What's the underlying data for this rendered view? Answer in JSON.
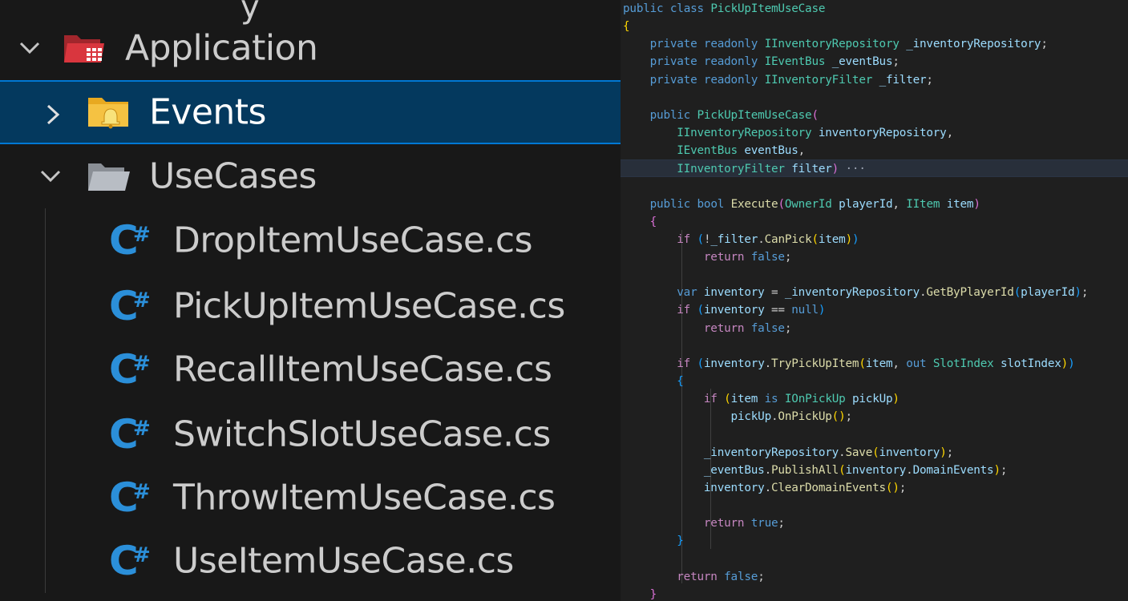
{
  "explorer": {
    "top_fragment": "y",
    "application": {
      "label": "Application",
      "expanded": true
    },
    "events": {
      "label": "Events",
      "expanded": false,
      "selected": true
    },
    "usecases": {
      "label": "UseCases",
      "expanded": true
    },
    "files": [
      {
        "label": "DropItemUseCase.cs"
      },
      {
        "label": "PickUpItemUseCase.cs"
      },
      {
        "label": "RecallItemUseCase.cs"
      },
      {
        "label": "SwitchSlotUseCase.cs"
      },
      {
        "label": "ThrowItemUseCase.cs"
      },
      {
        "label": "UseItemUseCase.cs"
      }
    ],
    "file_icon_text": {
      "c": "C",
      "hash": "#"
    }
  },
  "editor": {
    "colors": {
      "keyword": "#569cd6",
      "type": "#4ec9b0",
      "function": "#dcdcaa",
      "identifier": "#9cdcfe",
      "bracket_level_1": "#ffd700",
      "bracket_level_2": "#da70d6",
      "bracket_level_3": "#179fff"
    },
    "lines": [
      [
        [
          "kw",
          "public"
        ],
        [
          "pu",
          " "
        ],
        [
          "kw",
          "class"
        ],
        [
          "pu",
          " "
        ],
        [
          "ty",
          "PickUpItemUseCase"
        ]
      ],
      [
        [
          "b1",
          "{"
        ]
      ],
      [
        [
          "pu",
          "    "
        ],
        [
          "kw",
          "private"
        ],
        [
          "pu",
          " "
        ],
        [
          "kw",
          "readonly"
        ],
        [
          "pu",
          " "
        ],
        [
          "ty",
          "IInventoryRepository"
        ],
        [
          "pu",
          " "
        ],
        [
          "id",
          "_inventoryRepository"
        ],
        [
          "pu",
          ";"
        ]
      ],
      [
        [
          "pu",
          "    "
        ],
        [
          "kw",
          "private"
        ],
        [
          "pu",
          " "
        ],
        [
          "kw",
          "readonly"
        ],
        [
          "pu",
          " "
        ],
        [
          "ty",
          "IEventBus"
        ],
        [
          "pu",
          " "
        ],
        [
          "id",
          "_eventBus"
        ],
        [
          "pu",
          ";"
        ]
      ],
      [
        [
          "pu",
          "    "
        ],
        [
          "kw",
          "private"
        ],
        [
          "pu",
          " "
        ],
        [
          "kw",
          "readonly"
        ],
        [
          "pu",
          " "
        ],
        [
          "ty",
          "IInventoryFilter"
        ],
        [
          "pu",
          " "
        ],
        [
          "id",
          "_filter"
        ],
        [
          "pu",
          ";"
        ]
      ],
      [],
      [
        [
          "pu",
          "    "
        ],
        [
          "kw",
          "public"
        ],
        [
          "pu",
          " "
        ],
        [
          "ty",
          "PickUpItemUseCase"
        ],
        [
          "b2",
          "("
        ]
      ],
      [
        [
          "pu",
          "        "
        ],
        [
          "ty",
          "IInventoryRepository"
        ],
        [
          "pu",
          " "
        ],
        [
          "id",
          "inventoryRepository"
        ],
        [
          "pu",
          ","
        ]
      ],
      [
        [
          "pu",
          "        "
        ],
        [
          "ty",
          "IEventBus"
        ],
        [
          "pu",
          " "
        ],
        [
          "id",
          "eventBus"
        ],
        [
          "pu",
          ","
        ]
      ],
      [
        [
          "pu",
          "        "
        ],
        [
          "ty",
          "IInventoryFilter"
        ],
        [
          "pu",
          " "
        ],
        [
          "id",
          "filter"
        ],
        [
          "b2",
          ")"
        ],
        [
          "ell",
          " ···"
        ]
      ],
      [],
      [
        [
          "pu",
          "    "
        ],
        [
          "kw",
          "public"
        ],
        [
          "pu",
          " "
        ],
        [
          "kw",
          "bool"
        ],
        [
          "pu",
          " "
        ],
        [
          "fn",
          "Execute"
        ],
        [
          "b2",
          "("
        ],
        [
          "ty",
          "OwnerId"
        ],
        [
          "pu",
          " "
        ],
        [
          "id",
          "playerId"
        ],
        [
          "pu",
          ", "
        ],
        [
          "ty",
          "IItem"
        ],
        [
          "pu",
          " "
        ],
        [
          "id",
          "item"
        ],
        [
          "b2",
          ")"
        ]
      ],
      [
        [
          "pu",
          "    "
        ],
        [
          "b2",
          "{"
        ]
      ],
      [
        [
          "pu",
          "        "
        ],
        [
          "ctl",
          "if"
        ],
        [
          "pu",
          " "
        ],
        [
          "b3",
          "("
        ],
        [
          "pu",
          "!"
        ],
        [
          "id",
          "_filter"
        ],
        [
          "pu",
          "."
        ],
        [
          "fn",
          "CanPick"
        ],
        [
          "b1",
          "("
        ],
        [
          "id",
          "item"
        ],
        [
          "b1",
          ")"
        ],
        [
          "b3",
          ")"
        ]
      ],
      [
        [
          "pu",
          "            "
        ],
        [
          "ctl",
          "return"
        ],
        [
          "pu",
          " "
        ],
        [
          "kw",
          "false"
        ],
        [
          "pu",
          ";"
        ]
      ],
      [],
      [
        [
          "pu",
          "        "
        ],
        [
          "kw",
          "var"
        ],
        [
          "pu",
          " "
        ],
        [
          "id",
          "inventory"
        ],
        [
          "pu",
          " = "
        ],
        [
          "id",
          "_inventoryRepository"
        ],
        [
          "pu",
          "."
        ],
        [
          "fn",
          "GetByPlayerId"
        ],
        [
          "b3",
          "("
        ],
        [
          "id",
          "playerId"
        ],
        [
          "b3",
          ")"
        ],
        [
          "pu",
          ";"
        ]
      ],
      [
        [
          "pu",
          "        "
        ],
        [
          "ctl",
          "if"
        ],
        [
          "pu",
          " "
        ],
        [
          "b3",
          "("
        ],
        [
          "id",
          "inventory"
        ],
        [
          "pu",
          " == "
        ],
        [
          "kw",
          "null"
        ],
        [
          "b3",
          ")"
        ]
      ],
      [
        [
          "pu",
          "            "
        ],
        [
          "ctl",
          "return"
        ],
        [
          "pu",
          " "
        ],
        [
          "kw",
          "false"
        ],
        [
          "pu",
          ";"
        ]
      ],
      [],
      [
        [
          "pu",
          "        "
        ],
        [
          "ctl",
          "if"
        ],
        [
          "pu",
          " "
        ],
        [
          "b3",
          "("
        ],
        [
          "id",
          "inventory"
        ],
        [
          "pu",
          "."
        ],
        [
          "fn",
          "TryPickUpItem"
        ],
        [
          "b1",
          "("
        ],
        [
          "id",
          "item"
        ],
        [
          "pu",
          ", "
        ],
        [
          "kw",
          "out"
        ],
        [
          "pu",
          " "
        ],
        [
          "ty",
          "SlotIndex"
        ],
        [
          "pu",
          " "
        ],
        [
          "id",
          "slotIndex"
        ],
        [
          "b1",
          ")"
        ],
        [
          "b3",
          ")"
        ]
      ],
      [
        [
          "pu",
          "        "
        ],
        [
          "b3",
          "{"
        ]
      ],
      [
        [
          "pu",
          "            "
        ],
        [
          "ctl",
          "if"
        ],
        [
          "pu",
          " "
        ],
        [
          "b1",
          "("
        ],
        [
          "id",
          "item"
        ],
        [
          "pu",
          " "
        ],
        [
          "kw",
          "is"
        ],
        [
          "pu",
          " "
        ],
        [
          "ty",
          "IOnPickUp"
        ],
        [
          "pu",
          " "
        ],
        [
          "id",
          "pickUp"
        ],
        [
          "b1",
          ")"
        ]
      ],
      [
        [
          "pu",
          "                "
        ],
        [
          "id",
          "pickUp"
        ],
        [
          "pu",
          "."
        ],
        [
          "fn",
          "OnPickUp"
        ],
        [
          "b1",
          "()"
        ],
        [
          "pu",
          ";"
        ]
      ],
      [],
      [
        [
          "pu",
          "            "
        ],
        [
          "id",
          "_inventoryRepository"
        ],
        [
          "pu",
          "."
        ],
        [
          "fn",
          "Save"
        ],
        [
          "b1",
          "("
        ],
        [
          "id",
          "inventory"
        ],
        [
          "b1",
          ")"
        ],
        [
          "pu",
          ";"
        ]
      ],
      [
        [
          "pu",
          "            "
        ],
        [
          "id",
          "_eventBus"
        ],
        [
          "pu",
          "."
        ],
        [
          "fn",
          "PublishAll"
        ],
        [
          "b1",
          "("
        ],
        [
          "id",
          "inventory"
        ],
        [
          "pu",
          "."
        ],
        [
          "id",
          "DomainEvents"
        ],
        [
          "b1",
          ")"
        ],
        [
          "pu",
          ";"
        ]
      ],
      [
        [
          "pu",
          "            "
        ],
        [
          "id",
          "inventory"
        ],
        [
          "pu",
          "."
        ],
        [
          "fn",
          "ClearDomainEvents"
        ],
        [
          "b1",
          "()"
        ],
        [
          "pu",
          ";"
        ]
      ],
      [],
      [
        [
          "pu",
          "            "
        ],
        [
          "ctl",
          "return"
        ],
        [
          "pu",
          " "
        ],
        [
          "kw",
          "true"
        ],
        [
          "pu",
          ";"
        ]
      ],
      [
        [
          "pu",
          "        "
        ],
        [
          "b3",
          "}"
        ]
      ],
      [],
      [
        [
          "pu",
          "        "
        ],
        [
          "ctl",
          "return"
        ],
        [
          "pu",
          " "
        ],
        [
          "kw",
          "false"
        ],
        [
          "pu",
          ";"
        ]
      ],
      [
        [
          "pu",
          "    "
        ],
        [
          "b2",
          "}"
        ]
      ]
    ]
  }
}
